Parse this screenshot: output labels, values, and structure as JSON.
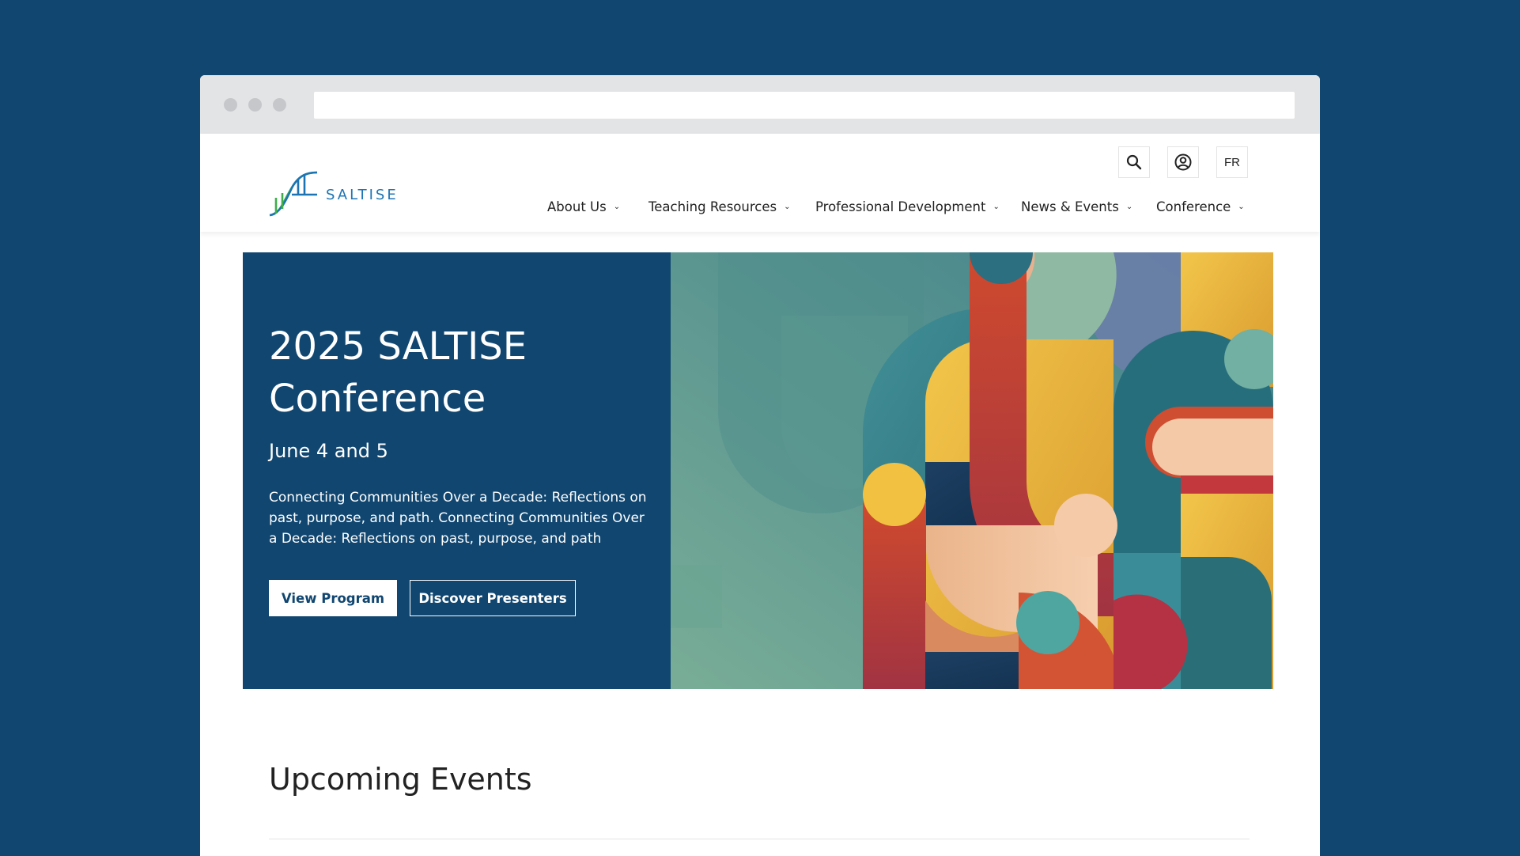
{
  "brand": {
    "name": "SALTISE"
  },
  "utility": {
    "lang_label": "FR"
  },
  "nav": {
    "items": [
      {
        "label": "About Us"
      },
      {
        "label": "Teaching Resources"
      },
      {
        "label": "Professional Development"
      },
      {
        "label": "News & Events"
      },
      {
        "label": "Conference"
      }
    ]
  },
  "hero": {
    "title": "2025 SALTISE Conference",
    "date": "June 4 and 5",
    "description": "Connecting Communities Over a Decade: Reflections on past, purpose, and path. Connecting Communities Over a Decade: Reflections on past, purpose, and path",
    "primary_button": "View Program",
    "secondary_button": "Discover Presenters"
  },
  "upcoming": {
    "title": "Upcoming Events"
  },
  "colors": {
    "navy": "#104670",
    "brand_blue": "#1c74b5",
    "brand_green": "#3fae4a"
  },
  "icons": [
    "search-icon",
    "account-icon",
    "chevron-down-icon"
  ]
}
